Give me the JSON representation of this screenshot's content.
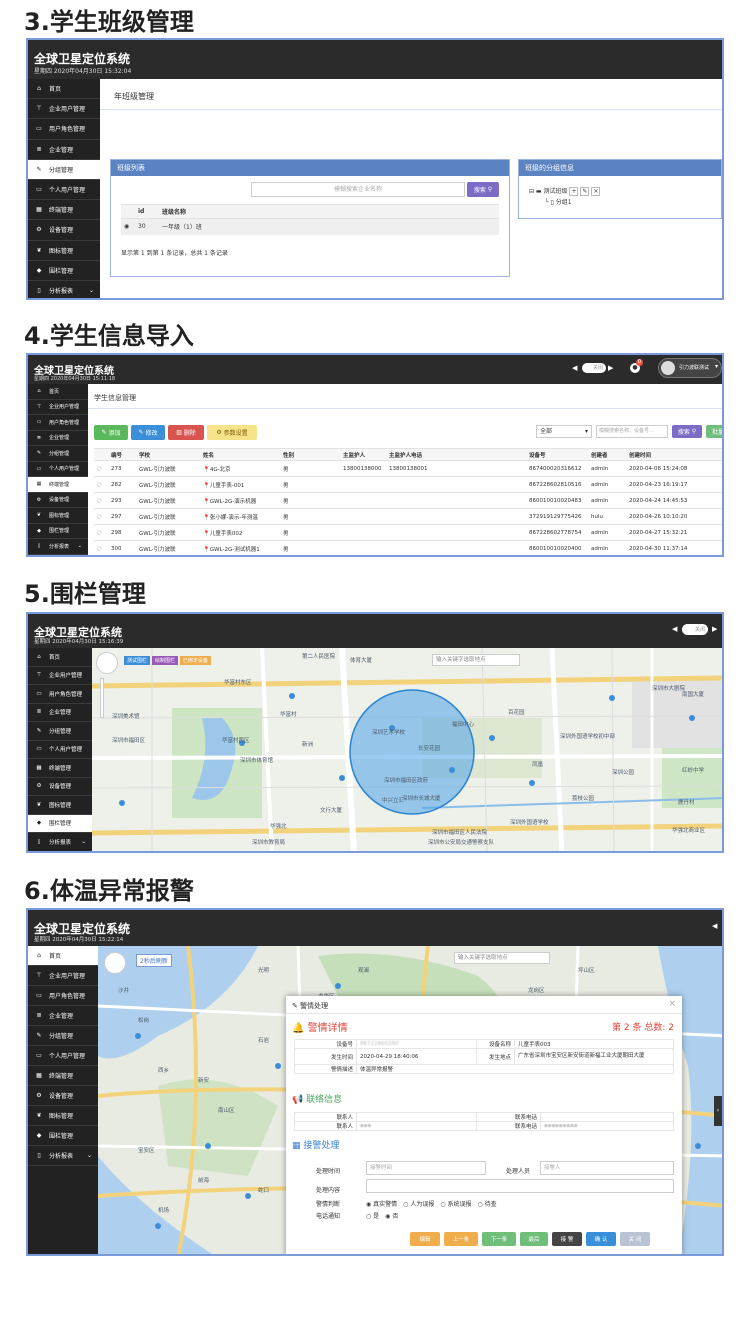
{
  "sections": [
    {
      "title": "3.学生班级管理"
    },
    {
      "title": "4.学生信息导入"
    },
    {
      "title": "5.围栏管理"
    },
    {
      "title": "6.体温异常报警"
    }
  ],
  "app": {
    "title": "全球卫星定位系统",
    "datetimes": [
      "星期四 2020年04月30日 15:32:04",
      "星期四 2020年04月30日 15:11:18",
      "星期四 2020年04月30日 15:16:39",
      "星期四 2020年04月30日 15:22:14"
    ]
  },
  "sidebar": {
    "items": [
      {
        "label": "首页",
        "icon": "home-icon",
        "glyph": "⌂"
      },
      {
        "label": "企业用户管理",
        "icon": "sitemap-icon",
        "glyph": "⊤"
      },
      {
        "label": "用户角色管理",
        "icon": "monitor-icon",
        "glyph": "▭"
      },
      {
        "label": "企业管理",
        "icon": "list-icon",
        "glyph": "≣"
      },
      {
        "label": "分组管理",
        "icon": "edit-icon",
        "glyph": "✎"
      },
      {
        "label": "个人用户管理",
        "icon": "desktop-icon",
        "glyph": "▭"
      },
      {
        "label": "终端管理",
        "icon": "calendar-icon",
        "glyph": "▦"
      },
      {
        "label": "设备管理",
        "icon": "gear-icon",
        "glyph": "⚙"
      },
      {
        "label": "图标管理",
        "icon": "leaf-icon",
        "glyph": "❦"
      },
      {
        "label": "围栏管理",
        "icon": "tag-icon",
        "glyph": "◆"
      },
      {
        "label": "分析报表",
        "icon": "file-icon",
        "glyph": "▯"
      }
    ],
    "active": [
      4,
      6,
      9,
      0
    ]
  },
  "s3": {
    "breadcrumb": "年班级管理",
    "list_panel_title": "班级列表",
    "search_placeholder": "模糊搜索企业名称",
    "search_button": "搜索",
    "columns": [
      "id",
      "班级名称"
    ],
    "rows": [
      {
        "id": "30",
        "name": "一年级（1）班"
      }
    ],
    "footer": "显示第 1 到第 1 条记录，总共 1 条记录",
    "group_panel_title": "班级的分组信息",
    "tree_root": "测试班级",
    "tree_child": "分组1"
  },
  "s4": {
    "page_title": "学生信息管理",
    "buttons": {
      "add": "添加",
      "edit": "修改",
      "delete": "删除",
      "params": "参数设置",
      "search": "搜索",
      "import": "批量导入"
    },
    "filter_value": "全部",
    "search_placeholder": "模糊搜索名称、设备号...",
    "header_right": {
      "toggle_label": "关闭",
      "badge_count": "0",
      "user": "引力波联测试"
    },
    "columns": [
      "编号",
      "学校",
      "姓名",
      "性别",
      "主监护人",
      "主监护人电话",
      "设备号",
      "创建者",
      "创建时间"
    ],
    "rows": [
      {
        "id": "273",
        "school": "GWL-引力波联",
        "name": "4G-北京",
        "gender": "男",
        "guardian": "13800138000",
        "phone": "13800138001",
        "device": "867400020316612",
        "creator": "admin",
        "created": "2020-04-08 15:24:08"
      },
      {
        "id": "282",
        "school": "GWL-引力波联",
        "name": "儿童手表-001",
        "gender": "男",
        "guardian": "",
        "phone": "",
        "device": "867228602810516",
        "creator": "admin",
        "created": "2020-04-23 16:19:17"
      },
      {
        "id": "293",
        "school": "GWL-引力波联",
        "name": "GWL-2G-演示机器",
        "gender": "男",
        "guardian": "",
        "phone": "",
        "device": "860010010020483",
        "creator": "admin",
        "created": "2020-04-24 14:45:53"
      },
      {
        "id": "297",
        "school": "GWL-引力波联",
        "name": "张小娜-演示-年测温",
        "gender": "男",
        "guardian": "",
        "phone": "",
        "device": "372919129775426",
        "creator": "hulu",
        "created": "2020-04-26 10:10:20"
      },
      {
        "id": "298",
        "school": "GWL-引力波联",
        "name": "儿童手表002",
        "gender": "男",
        "guardian": "",
        "phone": "",
        "device": "867228602778754",
        "creator": "admin",
        "created": "2020-04-27 15:32:21"
      },
      {
        "id": "300",
        "school": "GWL-引力波联",
        "name": "GWL-2G-测试机器1",
        "gender": "男",
        "guardian": "",
        "phone": "",
        "device": "860010010020400",
        "creator": "admin",
        "created": "2020-04-30 11:37:14"
      }
    ]
  },
  "s5": {
    "map_tags": [
      "测试围栏",
      "绘制围栏",
      "已绑定设备"
    ],
    "search_placeholder": "输入关键字选取地点",
    "toggle_label": "关闭",
    "labels": [
      "第二人民医院",
      "体育大厦",
      "深圳美术馆",
      "华富村东区",
      "华富村",
      "深圳市福田区",
      "华富村西区",
      "深圳市体育馆",
      "新洲",
      "长安花园",
      "百花园",
      "深圳市福田区政府",
      "深圳市长城大厦",
      "深圳市大剧院",
      "文行大厦",
      "中兴立汇",
      "华强北",
      "深圳艺术学校",
      "深圳外国语学校",
      "福田中心",
      "凤凰",
      "荔枝公园",
      "深圳公园",
      "红岭中学",
      "鹿丹村",
      "深圳市福田区人民法院",
      "深圳市公安局交通警察支队",
      "深圳市教育局",
      "深圳外国语学校初中部",
      "南国大厦",
      "华强北商业区"
    ]
  },
  "s6": {
    "refresh_tag": "2秒后刷新",
    "search_placeholder": "输入关键字选取地点",
    "modal_title": "警情处理",
    "detail_title": "警情详情",
    "pager": "第 2 条 总数: 2",
    "kv": {
      "device_label": "设备号",
      "device_value": "86722860280",
      "devname_label": "设备名称",
      "devname_value": "儿童手表003",
      "time_label": "发生时间",
      "time_value": "2020-04-29 18:40:06",
      "place_label": "发生地点",
      "place_value": "广东省深圳市宝安区新安街道新福工业大厦朝田大厦",
      "desc_label": "警情描述",
      "desc_value": "体温异常报警"
    },
    "contact_title": "联络信息",
    "contact": {
      "c1": "联系人",
      "c2": "联系人",
      "p1": "联系电话",
      "p2": "联系电话"
    },
    "handle_title": "接警处理",
    "handle": {
      "time_label": "处理时间",
      "time_placeholder": "接警时间",
      "person_label": "处理人员",
      "person_placeholder": "接警人",
      "content_label": "处理内容",
      "judge_label": "警情判断",
      "judge_options": [
        "真实警情",
        "人为误报",
        "系统误报",
        "待查"
      ],
      "notify_label": "电话通知",
      "notify_options": [
        "是",
        "否"
      ]
    },
    "buttons": [
      "编辑",
      "上一条",
      "下一条",
      "最后",
      "接 警",
      "确 认",
      "关 闭"
    ],
    "map_labels": [
      "梧桐山",
      "深圳",
      "福田区",
      "南山区",
      "宝安区",
      "龙华区",
      "罗湖区",
      "西乡",
      "新安",
      "沙井",
      "松岗",
      "光明",
      "石岩",
      "观澜",
      "布吉",
      "横岗",
      "盐田区",
      "大鹏新区",
      "坪山区",
      "龙岗区",
      "东门",
      "华侨城",
      "蛇口",
      "前海",
      "机场",
      "香港"
    ]
  }
}
